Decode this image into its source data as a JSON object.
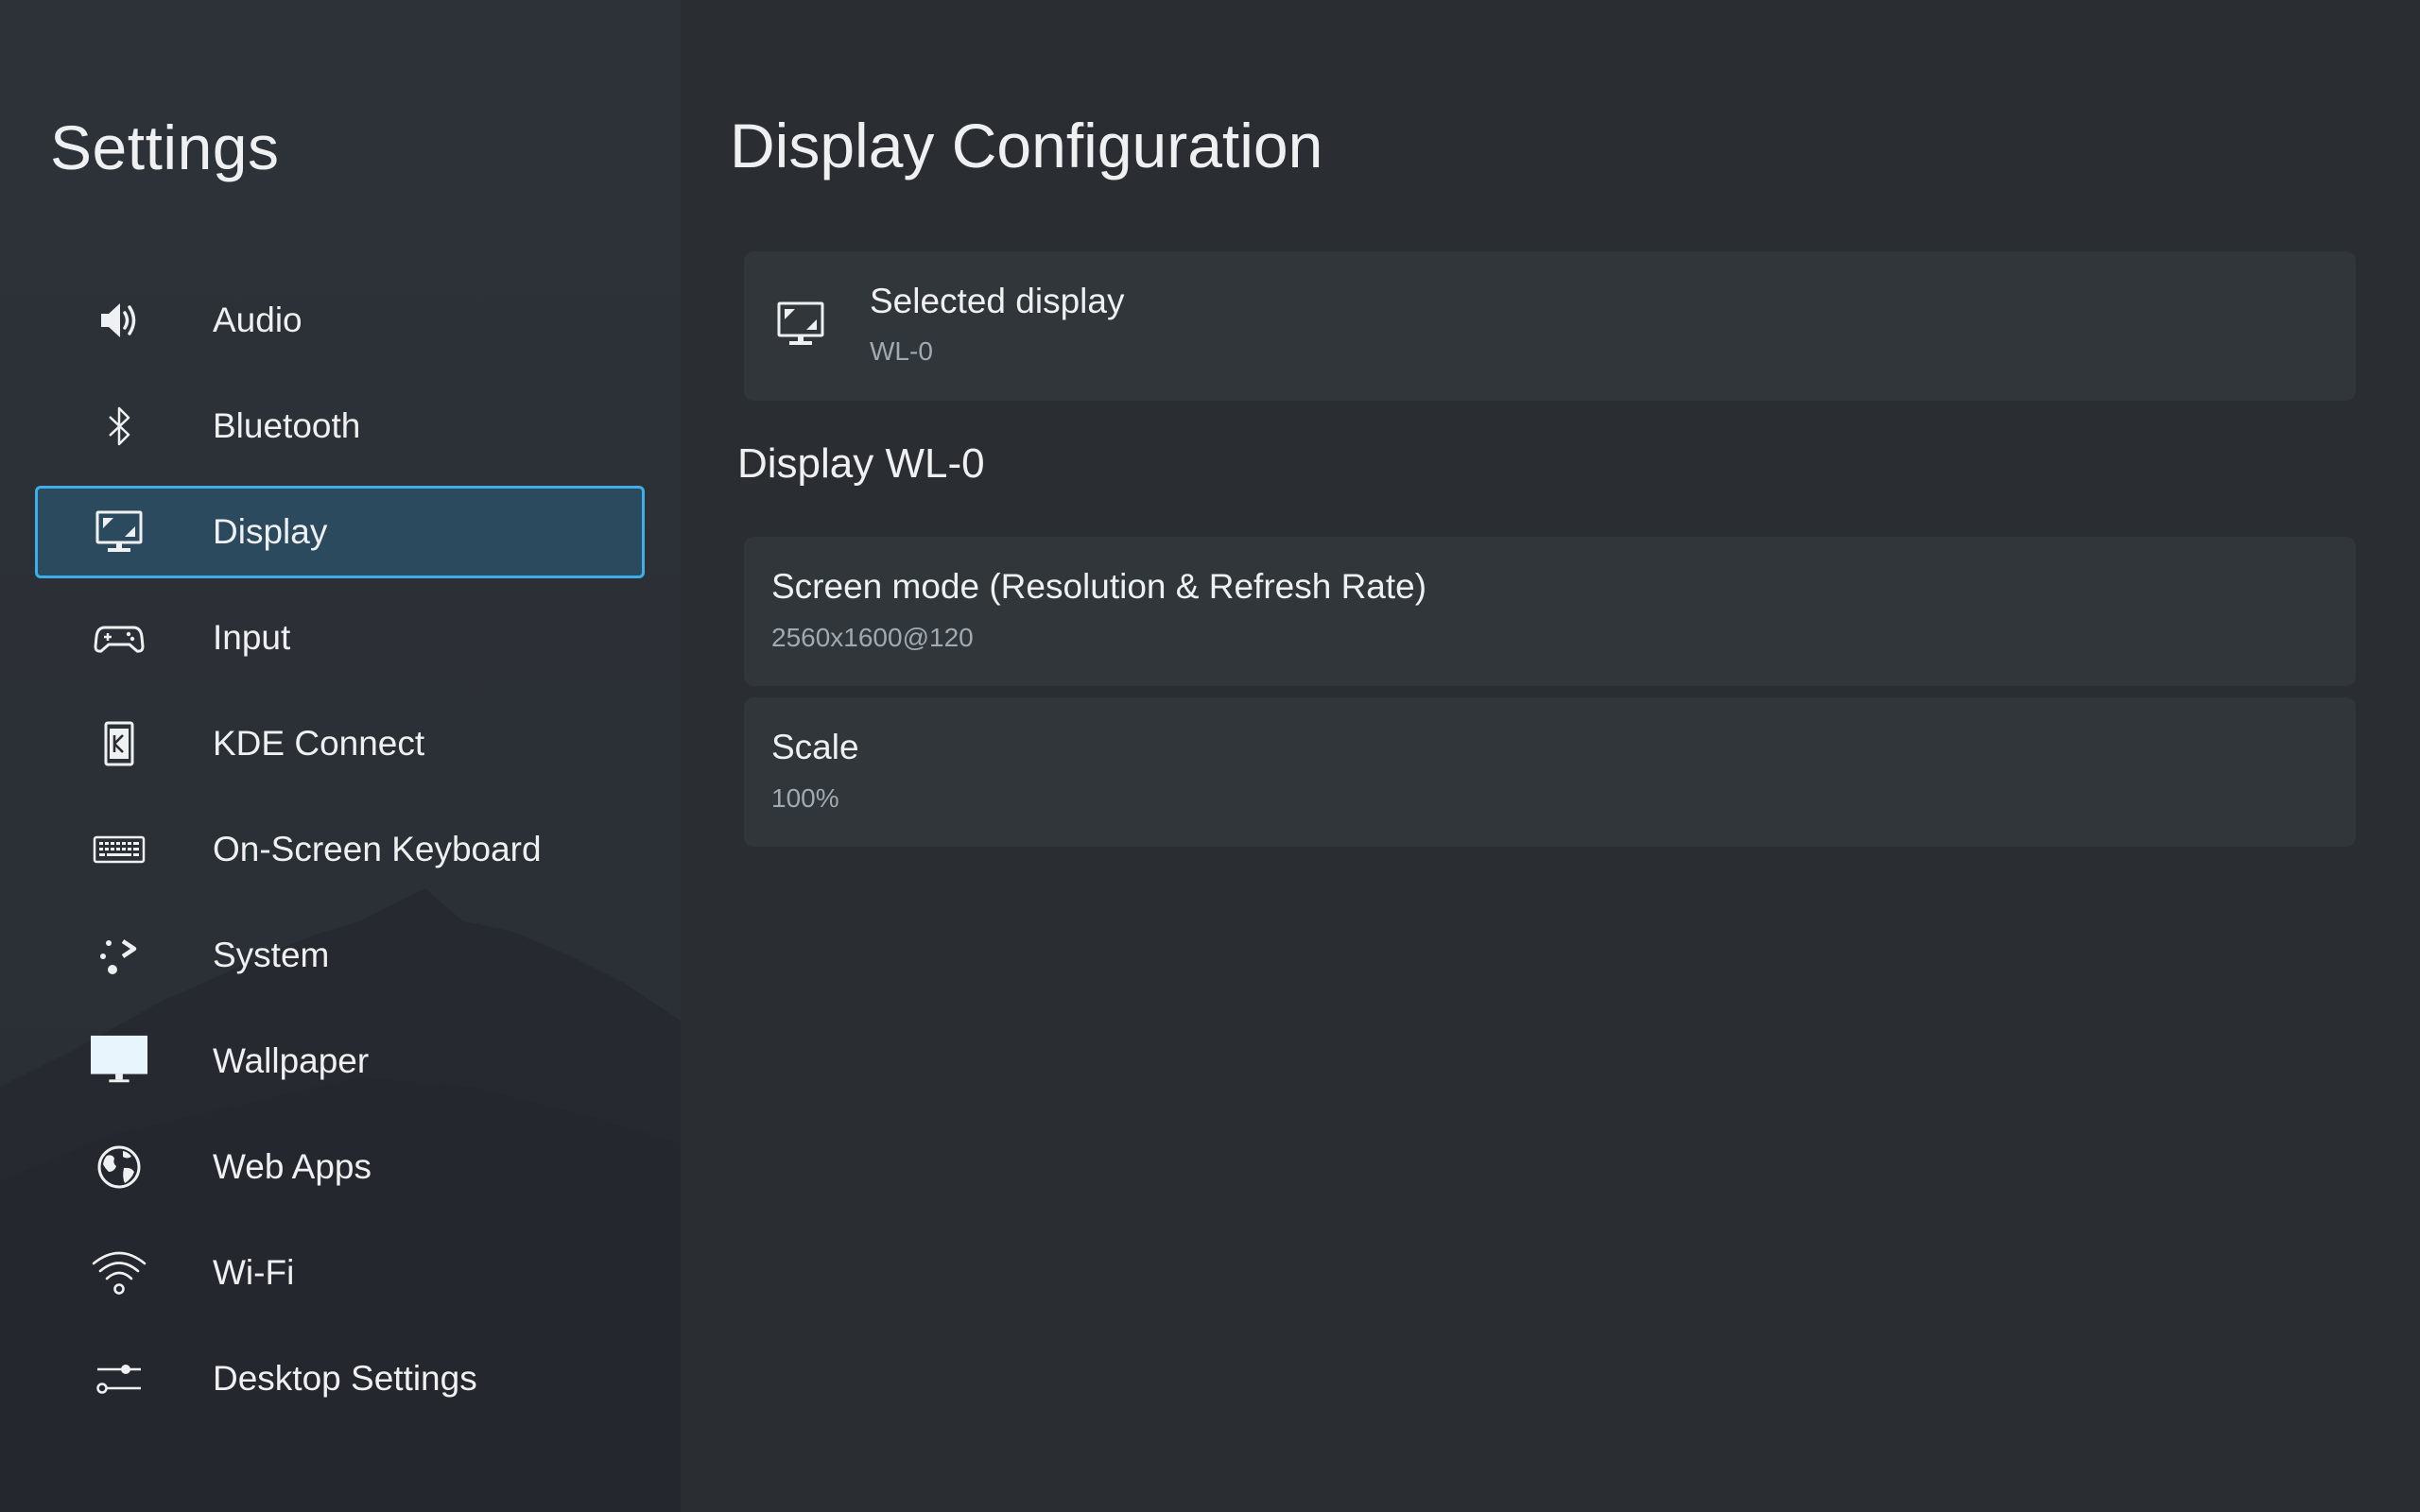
{
  "sidebar": {
    "title": "Settings",
    "items": [
      {
        "label": "Audio",
        "icon": "speaker-icon"
      },
      {
        "label": "Bluetooth",
        "icon": "bluetooth-icon"
      },
      {
        "label": "Display",
        "icon": "monitor-icon",
        "active": true
      },
      {
        "label": "Input",
        "icon": "gamepad-icon"
      },
      {
        "label": "KDE Connect",
        "icon": "kde-connect-icon"
      },
      {
        "label": "On-Screen Keyboard",
        "icon": "keyboard-icon"
      },
      {
        "label": "System",
        "icon": "system-icon"
      },
      {
        "label": "Wallpaper",
        "icon": "wallpaper-icon"
      },
      {
        "label": "Web Apps",
        "icon": "globe-icon"
      },
      {
        "label": "Wi-Fi",
        "icon": "wifi-icon"
      },
      {
        "label": "Desktop Settings",
        "icon": "sliders-icon"
      }
    ]
  },
  "main": {
    "title": "Display Configuration",
    "selected_display": {
      "label": "Selected display",
      "value": "WL-0",
      "icon": "monitor-icon"
    },
    "section_title": "Display WL-0",
    "screen_mode": {
      "label": "Screen mode (Resolution & Refresh Rate)",
      "value": "2560x1600@120"
    },
    "scale": {
      "label": "Scale",
      "value": "100%"
    }
  },
  "colors": {
    "accent": "#3daee9",
    "active_bg": "#2c4a5e",
    "background": "#2a2e32",
    "card": "#31363b",
    "text": "#eff0f1",
    "subtext": "#a1a9b1"
  }
}
